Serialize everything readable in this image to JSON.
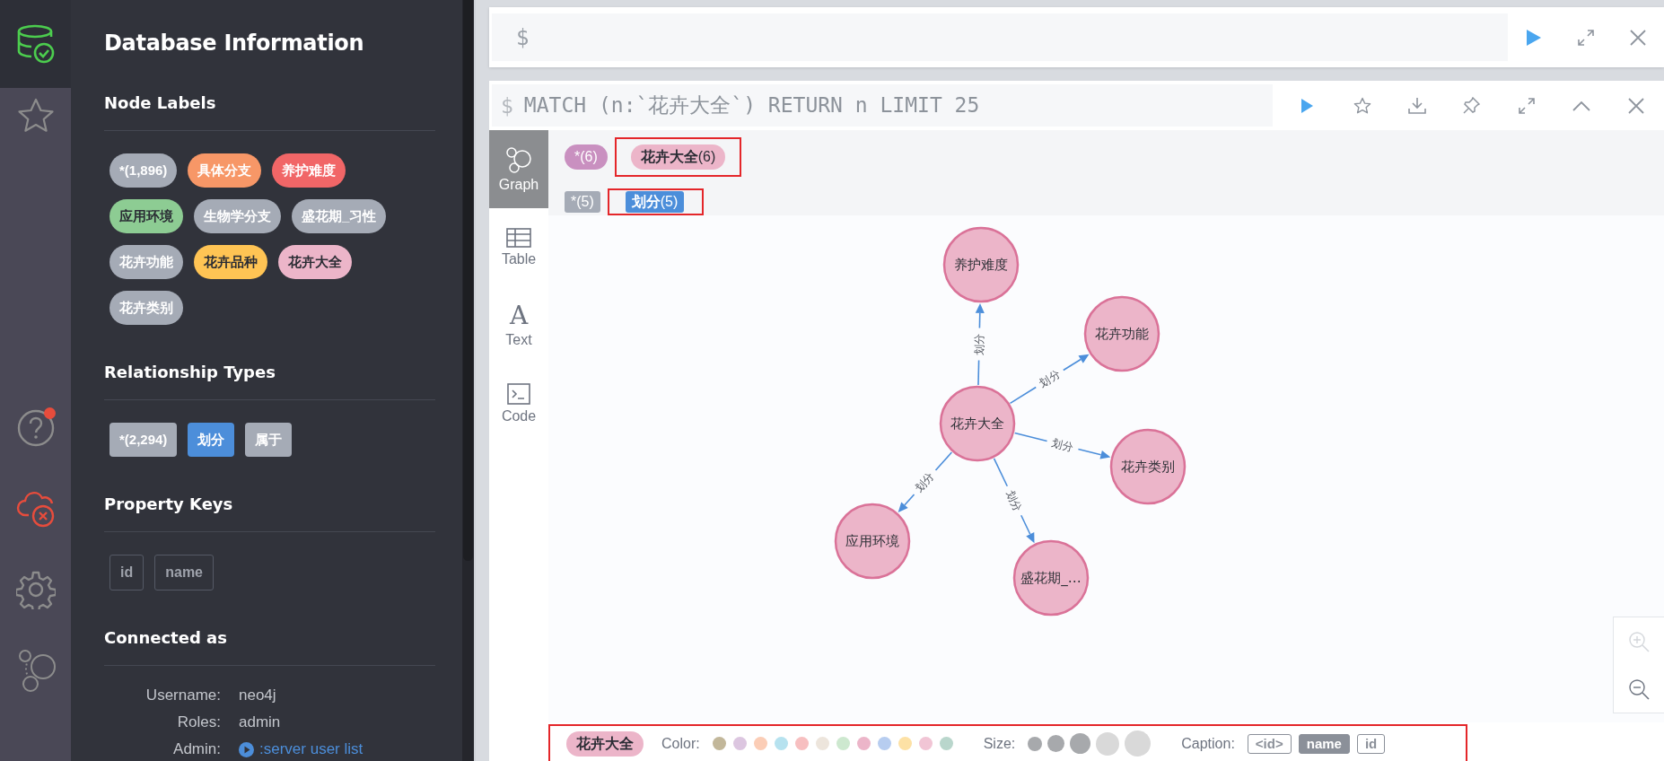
{
  "nav": {
    "items": [
      {
        "kind": "database",
        "selected": true
      },
      {
        "kind": "favorites",
        "selected": false
      },
      {
        "kind": "help",
        "selected": false,
        "notification": true
      },
      {
        "kind": "connection-error",
        "selected": false
      },
      {
        "kind": "settings",
        "selected": false
      },
      {
        "kind": "about",
        "selected": false
      }
    ]
  },
  "sidebar": {
    "title": "Database Information",
    "node_labels": {
      "heading": "Node Labels",
      "items": [
        {
          "label": "*(1,896)",
          "color": "#a5abb6"
        },
        {
          "label": "具体分支",
          "color": "#f79767"
        },
        {
          "label": "养护难度",
          "color": "#f16667"
        },
        {
          "label": "应用环境",
          "color": "#8dcc93"
        },
        {
          "label": "生物学分支",
          "color": "#a5abb6"
        },
        {
          "label": "盛花期_习性",
          "color": "#a5abb6"
        },
        {
          "label": "花卉功能",
          "color": "#a5abb6"
        },
        {
          "label": "花卉品种",
          "color": "#ffc454"
        },
        {
          "label": "花卉大全",
          "color": "#ecb5c9"
        },
        {
          "label": "花卉类别",
          "color": "#a5abb6"
        }
      ]
    },
    "relationship_types": {
      "heading": "Relationship Types",
      "items": [
        {
          "label": "*(2,294)",
          "color": "#a5abb6"
        },
        {
          "label": "划分",
          "color": "#4c8eda"
        },
        {
          "label": "属于",
          "color": "#a5abb6"
        }
      ]
    },
    "property_keys": {
      "heading": "Property Keys",
      "items": [
        "id",
        "name"
      ]
    },
    "connection": {
      "heading": "Connected as",
      "rows": [
        {
          "key": "Username:",
          "value": "neo4j",
          "kind": "text"
        },
        {
          "key": "Roles:",
          "value": "admin",
          "kind": "text"
        },
        {
          "key": "Admin:",
          "value": ":server user list",
          "kind": "link"
        }
      ]
    }
  },
  "editor": {
    "prompt": "$"
  },
  "frame": {
    "prompt": "$",
    "query": "MATCH (n:`花卉大全`) RETURN n LIMIT 25",
    "tabs": [
      {
        "label": "Graph",
        "kind": "graph",
        "selected": true
      },
      {
        "label": "Table",
        "kind": "table",
        "selected": false
      },
      {
        "label": "Text",
        "kind": "text",
        "icon": "A",
        "selected": false
      },
      {
        "label": "Code",
        "kind": "code",
        "selected": false
      }
    ],
    "legend": {
      "labels": [
        {
          "label": "*(6)",
          "color": "#c990c0",
          "highlighted": false
        },
        {
          "label": "**花卉大全**(6)",
          "color": "#ecb5c9",
          "highlighted": true
        }
      ],
      "relationships": [
        {
          "label": "*(5)",
          "color": "#a5abb6",
          "highlighted": false
        },
        {
          "label": "**划分**(5)",
          "color": "#4c8eda",
          "highlighted": true
        }
      ]
    },
    "graph": {
      "nodes": [
        {
          "caption": "花卉大全"
        },
        {
          "caption": "养护难度"
        },
        {
          "caption": "花卉功能"
        },
        {
          "caption": "花卉类别"
        },
        {
          "caption": "应用环境"
        },
        {
          "caption": "盛花期_…"
        }
      ],
      "relationships": [
        {
          "type": "划分"
        },
        {
          "type": "划分"
        },
        {
          "type": "划分"
        },
        {
          "type": "划分"
        },
        {
          "type": "划分"
        }
      ]
    },
    "zoom_controls": [
      {
        "kind": "zoom-in",
        "disabled": true
      },
      {
        "kind": "zoom-out",
        "disabled": false
      }
    ],
    "inspector": {
      "highlighted": true,
      "label_pill": {
        "label": "花卉大全",
        "color": "#ecb5c9"
      },
      "color_heading": "Color:",
      "colors": [
        {
          "color": "#c2b79a"
        },
        {
          "color": "#dcc6e0"
        },
        {
          "color": "#fbcdb6"
        },
        {
          "color": "#b6e2ef"
        },
        {
          "color": "#f7bfc0"
        },
        {
          "color": "#ede5dc"
        },
        {
          "color": "#cde8cf"
        },
        {
          "color": "#ecb5c9"
        },
        {
          "color": "#b7cdf0"
        },
        {
          "color": "#fde1a5"
        },
        {
          "color": "#f1c5d5"
        },
        {
          "color": "#b9d6cc"
        }
      ],
      "size_heading": "Size:",
      "sizes": [
        {
          "active": true
        },
        {
          "active": true
        },
        {
          "active": true
        },
        {
          "active": false
        },
        {
          "active": false
        }
      ],
      "caption_heading": "Caption:",
      "captions": [
        {
          "label": "<id>",
          "selected": false
        },
        {
          "label": "name",
          "selected": true
        },
        {
          "label": "id",
          "selected": false
        }
      ]
    }
  }
}
